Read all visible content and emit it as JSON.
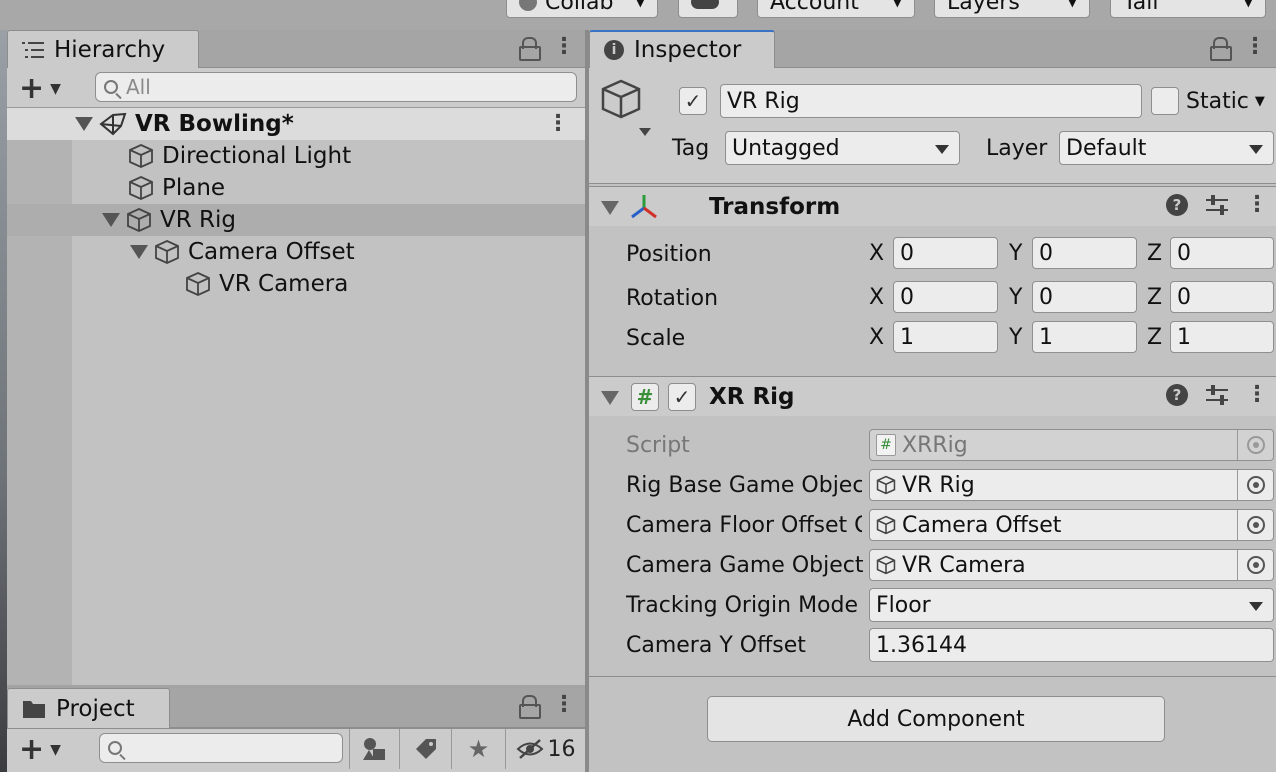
{
  "toolbar": {
    "collab_label": "Collab",
    "account_label": "Account",
    "layers_label": "Layers",
    "layout_label": "Tall"
  },
  "hierarchy": {
    "tab_label": "Hierarchy",
    "search_placeholder": "All",
    "scene_name": "VR Bowling*",
    "items": [
      {
        "label": "Directional Light"
      },
      {
        "label": "Plane"
      },
      {
        "label": "VR Rig"
      },
      {
        "label": "Camera Offset"
      },
      {
        "label": "VR Camera"
      }
    ]
  },
  "project": {
    "tab_label": "Project",
    "hidden_count": "16"
  },
  "inspector": {
    "tab_label": "Inspector",
    "object_name": "VR Rig",
    "static_label": "Static",
    "tag_label": "Tag",
    "tag_value": "Untagged",
    "layer_label": "Layer",
    "layer_value": "Default",
    "transform": {
      "title": "Transform",
      "rows": [
        {
          "label": "Position",
          "x": "0",
          "y": "0",
          "z": "0"
        },
        {
          "label": "Rotation",
          "x": "0",
          "y": "0",
          "z": "0"
        },
        {
          "label": "Scale",
          "x": "1",
          "y": "1",
          "z": "1"
        }
      ],
      "axis_x": "X",
      "axis_y": "Y",
      "axis_z": "Z"
    },
    "xr_rig": {
      "title": "XR Rig",
      "script_label": "Script",
      "script_value": "XRRig",
      "rig_base_label": "Rig Base Game Object",
      "rig_base_value": "VR Rig",
      "floor_offset_label": "Camera Floor Offset Object",
      "floor_offset_value": "Camera Offset",
      "camera_go_label": "Camera Game Object",
      "camera_go_value": "VR Camera",
      "tracking_label": "Tracking Origin Mode",
      "tracking_value": "Floor",
      "y_offset_label": "Camera Y Offset",
      "y_offset_value": "1.36144"
    },
    "add_component_label": "Add Component"
  },
  "colors": {
    "panel_bg": "#c2c2c2",
    "tab_active_accent": "#3a72c4",
    "selected_row": "#adadad"
  }
}
